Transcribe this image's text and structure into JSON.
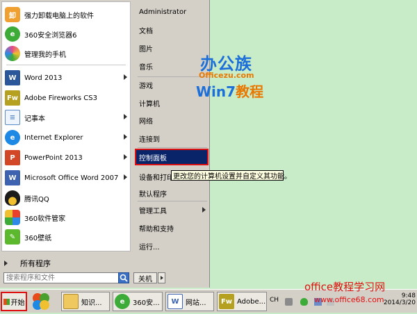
{
  "start_menu": {
    "programs": [
      {
        "label": "强力卸载电脑上的软件",
        "icon": "uninstall-icon",
        "color": "#f0a030"
      },
      {
        "label": "360安全浏览器6",
        "icon": "360-browser-icon",
        "color": "#3cab38"
      },
      {
        "label": "管理我的手机",
        "icon": "phone-manager-icon",
        "color": "#e84a8a"
      },
      {
        "label": "Word 2013",
        "icon": "word-icon",
        "color": "#2b579a",
        "has_submenu": true
      },
      {
        "label": "Adobe Fireworks CS3",
        "icon": "fireworks-icon",
        "color": "#b5a020"
      },
      {
        "label": "记事本",
        "icon": "notepad-icon",
        "color": "#5a8ac8",
        "has_submenu": true
      },
      {
        "label": "Internet Explorer",
        "icon": "ie-icon",
        "color": "#1e88e5",
        "has_submenu": true
      },
      {
        "label": "PowerPoint 2013",
        "icon": "powerpoint-icon",
        "color": "#d24726",
        "has_submenu": true
      },
      {
        "label": "Microsoft Office Word 2007",
        "icon": "word2007-icon",
        "color": "#3c62b0",
        "has_submenu": true
      },
      {
        "label": "腾讯QQ",
        "icon": "qq-icon",
        "color": "#1c1c1c"
      },
      {
        "label": "360软件管家",
        "icon": "360-software-icon",
        "color": "#e8402a"
      },
      {
        "label": "360壁纸",
        "icon": "360-wallpaper-icon",
        "color": "#5cb82c"
      }
    ],
    "all_programs": "所有程序",
    "search_placeholder": "搜索程序和文件",
    "right_items": [
      {
        "label": "Administrator"
      },
      {
        "label": "文档"
      },
      {
        "label": "图片"
      },
      {
        "label": "音乐"
      },
      {
        "label": "游戏"
      },
      {
        "label": "计算机"
      },
      {
        "label": "网络"
      },
      {
        "label": "连接到"
      },
      {
        "label": "控制面板"
      },
      {
        "label": "设备和打印"
      },
      {
        "label": "默认程序"
      },
      {
        "label": "管理工具",
        "has_submenu": true
      },
      {
        "label": "帮助和支持"
      },
      {
        "label": "运行..."
      }
    ],
    "shutdown_label": "关机",
    "tooltip": "更改您的计算机设置并自定义其功能。"
  },
  "watermark": {
    "logo_line1": "办公族",
    "logo_line2": "Officezu.com",
    "logo_line3a": "Win7",
    "logo_line3b": "教程",
    "site_line1": "office教程学习网",
    "site_line2": "www.office68.com"
  },
  "taskbar": {
    "start_label": "开始",
    "tasks": [
      {
        "label": "知识...",
        "icon": "folder-icon"
      },
      {
        "label": "360安...",
        "icon": "360-browser-icon"
      },
      {
        "label": "网站...",
        "icon": "document-icon"
      },
      {
        "label": "Adobe...",
        "icon": "fireworks-icon"
      }
    ],
    "language": "CH",
    "time": "9:48",
    "date": "2014/3/20"
  },
  "colors": {
    "selection": "#0a246a",
    "highlight_border": "#e01010",
    "desktop": "#c8ecc8"
  }
}
